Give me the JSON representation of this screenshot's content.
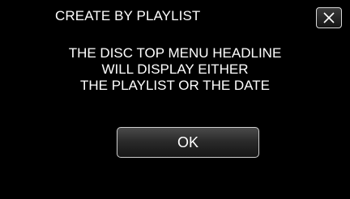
{
  "dialog": {
    "title": "CREATE BY PLAYLIST",
    "message_lines": [
      "THE DISC TOP MENU HEADLINE",
      "WILL DISPLAY EITHER",
      "THE PLAYLIST OR THE DATE"
    ],
    "ok_label": "OK",
    "close_icon": "close-x-icon"
  },
  "colors": {
    "background": "#000000",
    "text": "#ffffff",
    "button_border": "#cfcfcf"
  }
}
